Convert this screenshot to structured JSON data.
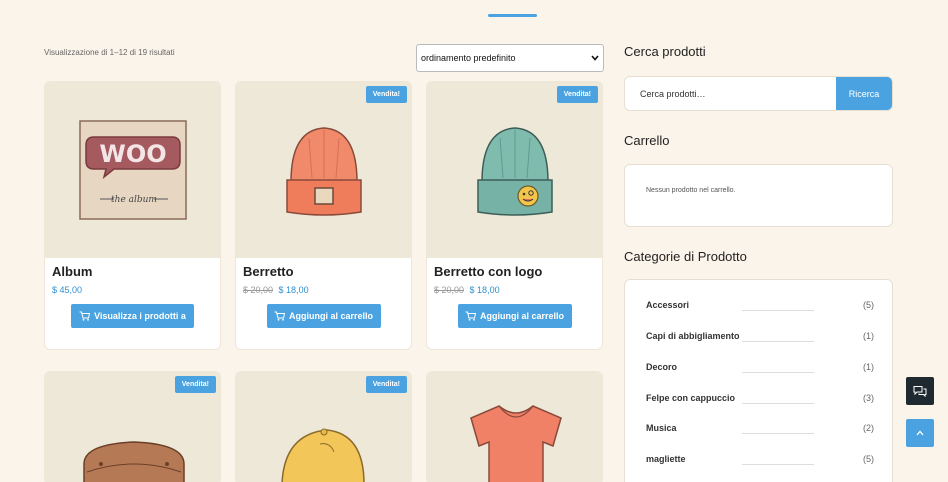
{
  "shop": {
    "result_count": "Visualizzazione di 1–12 di 19 risultati",
    "sort_selected": "ordinamento predefinito"
  },
  "products": [
    {
      "title": "Album",
      "sale_badge": "",
      "old_price": "",
      "price": "$ 45,00",
      "button": "Visualizza i prodotti a",
      "icon": "vinyl-album-icon"
    },
    {
      "title": "Berretto",
      "sale_badge": "Vendita!",
      "old_price": "$ 20,00",
      "price": "$ 18,00",
      "button": "Aggiungi al carrello",
      "icon": "beanie-icon"
    },
    {
      "title": "Berretto con logo",
      "sale_badge": "Vendita!",
      "old_price": "$ 20,00",
      "price": "$ 18,00",
      "button": "Aggiungi al carrello",
      "icon": "beanie-logo-icon"
    },
    {
      "title": "",
      "sale_badge": "Vendita!",
      "old_price": "",
      "price": "",
      "button": "",
      "icon": "belt-icon"
    },
    {
      "title": "",
      "sale_badge": "Vendita!",
      "old_price": "",
      "price": "",
      "button": "",
      "icon": "cap-icon"
    },
    {
      "title": "",
      "sale_badge": "",
      "old_price": "",
      "price": "",
      "button": "",
      "icon": "tshirt-icon"
    }
  ],
  "sidebar": {
    "search_title": "Cerca prodotti",
    "search_placeholder": "Cerca prodotti…",
    "search_button": "Ricerca",
    "cart_title": "Carrello",
    "cart_empty": "Nessun prodotto nel carrello.",
    "categories_title": "Categorie di Prodotto",
    "categories": [
      {
        "name": "Accessori",
        "count": "(5)"
      },
      {
        "name": "Capi di abbigliamento",
        "count": "(1)"
      },
      {
        "name": "Decoro",
        "count": "(1)"
      },
      {
        "name": "Felpe con cappuccio",
        "count": "(3)"
      },
      {
        "name": "Musica",
        "count": "(2)"
      },
      {
        "name": "magliette",
        "count": "(5)"
      }
    ]
  },
  "floating": {
    "chat_icon": "chat-bubbles-icon",
    "top_icon": "chevron-up-icon"
  },
  "colors": {
    "accent": "#4aa3e0",
    "page_bg": "#fbf4ea",
    "image_bg": "#ede8d8"
  }
}
